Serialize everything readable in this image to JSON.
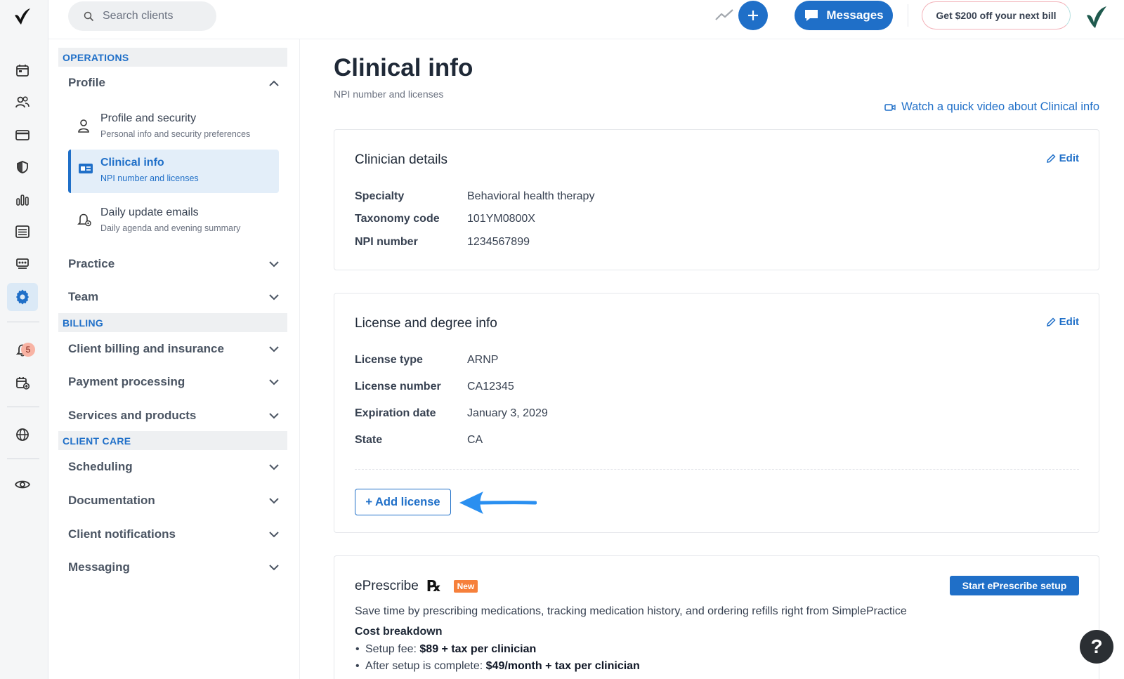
{
  "colors": {
    "brand": "#1f6fc8",
    "badge_new": "#f6803b"
  },
  "rail": {
    "notification_count": "5",
    "icons": [
      "calendar-icon",
      "clients-icon",
      "billing-card-icon",
      "shield-icon",
      "reports-icon",
      "list-icon",
      "marketplace-icon",
      "settings-gear-icon",
      "bell-icon",
      "calendar-add-icon",
      "globe-icon",
      "eye-icon"
    ]
  },
  "topbar": {
    "search_placeholder": "Search clients",
    "messages_label": "Messages",
    "promo_label": "Get $200 off your next bill"
  },
  "sidebar": {
    "operations_label": "OPERATIONS",
    "profile_label": "Profile",
    "profile_items": [
      {
        "title": "Profile and security",
        "subtitle": "Personal info and security preferences"
      },
      {
        "title": "Clinical info",
        "subtitle": "NPI number and licenses"
      },
      {
        "title": "Daily update emails",
        "subtitle": "Daily agenda and evening summary"
      }
    ],
    "practice_label": "Practice",
    "team_label": "Team",
    "billing_label": "BILLING",
    "billing_items": [
      "Client billing and insurance",
      "Payment processing",
      "Services and products"
    ],
    "client_care_label": "CLIENT CARE",
    "client_care_items": [
      "Scheduling",
      "Documentation",
      "Client notifications",
      "Messaging"
    ]
  },
  "main": {
    "title": "Clinical info",
    "subtitle": "NPI number and licenses",
    "video_link": "Watch a quick video about Clinical info",
    "clinician": {
      "title": "Clinician details",
      "edit_label": "Edit",
      "rows": [
        {
          "key": "Specialty",
          "value": "Behavioral health therapy"
        },
        {
          "key": "Taxonomy code",
          "value": "101YM0800X"
        },
        {
          "key": "NPI number",
          "value": "1234567899"
        }
      ]
    },
    "license": {
      "title": "License and degree info",
      "edit_label": "Edit",
      "rows": [
        {
          "key": "License type",
          "value": "ARNP"
        },
        {
          "key": "License number",
          "value": "CA12345"
        },
        {
          "key": "Expiration date",
          "value": "January 3, 2029"
        },
        {
          "key": "State",
          "value": "CA"
        }
      ],
      "add_label": "+ Add license"
    },
    "eprescribe": {
      "title": "ePrescribe",
      "rx_symbol": "℞",
      "badge": "New",
      "setup_label": "Start ePrescribe setup",
      "description": "Save time by prescribing medications, tracking medication history, and ordering refills right from SimplePractice",
      "cost_heading": "Cost breakdown",
      "cost_items": [
        {
          "prefix": "Setup fee: ",
          "amount": "$89 + tax per clinician"
        },
        {
          "prefix": "After setup is complete: ",
          "amount": "$49/month + tax per clinician"
        }
      ]
    }
  },
  "help_label": "?"
}
